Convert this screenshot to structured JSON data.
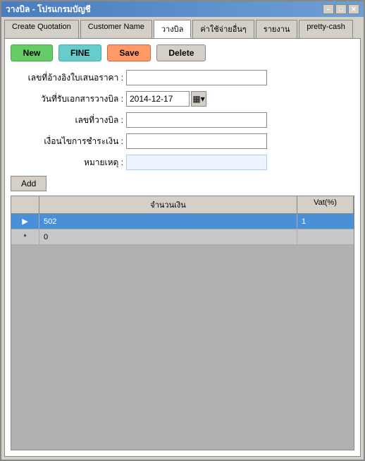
{
  "window": {
    "title": "วางบิล - โปรแกรมบัญชี"
  },
  "tabs": [
    {
      "label": "Create Quotation",
      "id": "create-quotation",
      "active": false
    },
    {
      "label": "Customer Name",
      "id": "customer-name",
      "active": false
    },
    {
      "label": "วางบิล",
      "id": "wangbil",
      "active": true
    },
    {
      "label": "ค่าใช้จ่ายอื่นๆ",
      "id": "kha-chai-jai",
      "active": false
    },
    {
      "label": "รายงาน",
      "id": "rayngarn",
      "active": false
    },
    {
      "label": "pretty-cash",
      "id": "pretty-cash",
      "active": false
    }
  ],
  "toolbar": {
    "new_label": "New",
    "fine_label": "FINE",
    "save_label": "Save",
    "delete_label": "Delete"
  },
  "form": {
    "ref_label": "เลขที่อ้างอิงใบเสนอราคา :",
    "date_label": "วันที่รับเอกสารวางบิล :",
    "date_value": "2014-12-17",
    "billno_label": "เลขที่วางบิล :",
    "condition_label": "เงื่อนไขการชำระเงิน :",
    "note_label": "หมายเหตุ :",
    "add_label": "Add"
  },
  "grid": {
    "col_amount": "จำนวนเงิน",
    "col_vat": "Vat(%)",
    "rows": [
      {
        "indicator": "▶",
        "amount": "502",
        "vat": "1",
        "selected": true
      },
      {
        "indicator": "*",
        "amount": "0",
        "vat": "",
        "selected": false
      }
    ]
  },
  "titlebar_buttons": {
    "minimize": "–",
    "maximize": "□",
    "close": "✕"
  }
}
